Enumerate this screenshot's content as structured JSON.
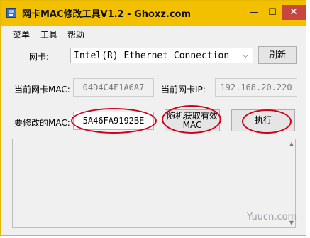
{
  "window": {
    "title": "网卡MAC修改工具V1.2 - Ghoxz.com",
    "minimize": "—",
    "maximize": "☐",
    "close": "✕"
  },
  "menu": [
    "菜单",
    "工具",
    "帮助"
  ],
  "adapter": {
    "label": "网卡:",
    "selected": "Intel(R) Ethernet Connection",
    "refresh_label": "刷新"
  },
  "current": {
    "mac_label": "当前网卡MAC:",
    "mac_value": "04D4C4F1A6A7",
    "ip_label": "当前网卡IP:",
    "ip_value": "192.168.20.220"
  },
  "modify": {
    "label": "要修改的MAC:",
    "value": "5A46FA9192BE",
    "random_label_line1": "随机获取有效",
    "random_label_line2": "MAC",
    "execute_label": "执行"
  },
  "watermark": "Yuucn.com",
  "colors": {
    "titlebar": "#f3c000",
    "annotation": "#d0001a",
    "close": "#c7463d"
  }
}
